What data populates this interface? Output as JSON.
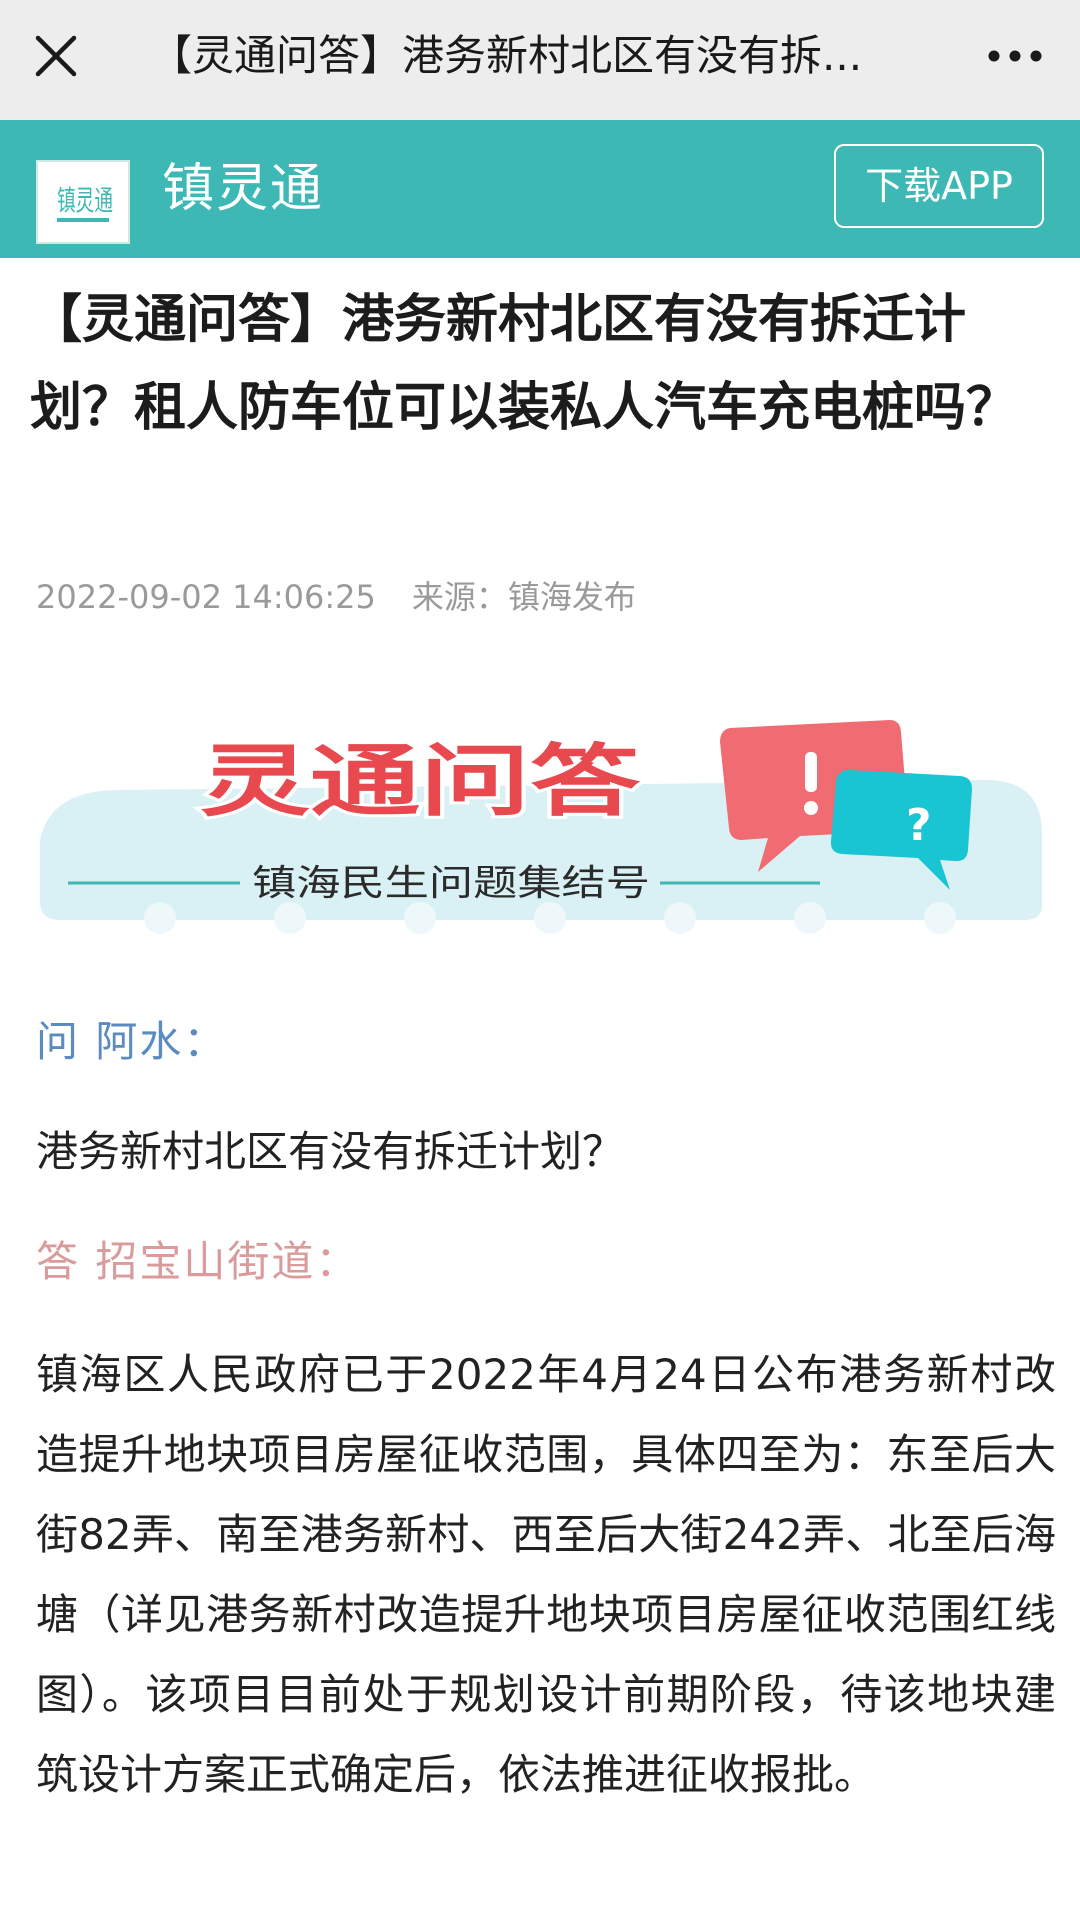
{
  "browser": {
    "title": "【灵通问答】港务新村北区有没有拆...",
    "close_icon": "close-icon",
    "more_icon": "more-icon"
  },
  "app": {
    "name": "镇灵通",
    "logo_text": "镇灵通",
    "download_label": "下载APP",
    "accent_color": "#3eb8b4"
  },
  "article": {
    "title": "【灵通问答】港务新村北区有没有拆迁计划？租人防车位可以装私人汽车充电桩吗？",
    "datetime": "2022-09-02 14:06:25",
    "source": "来源：镇海发布",
    "banner": {
      "heading": "灵通问答",
      "subheading": "镇海民生问题集结号"
    },
    "question_label": "问 阿水：",
    "question": "港务新村北区有没有拆迁计划？",
    "answer_label": "答 招宝山街道：",
    "answer": "镇海区人民政府已于2022年4月24日公布港务新村改造提升地块项目房屋征收范围，具体四至为：东至后大街82弄、南至港务新村、西至后大街242弄、北至后海塘（详见港务新村改造提升地块项目房屋征收范围红线图）。该项目目前处于规划设计前期阶段，待该地块建筑设计方案正式确定后，依法推进征收报批。"
  }
}
